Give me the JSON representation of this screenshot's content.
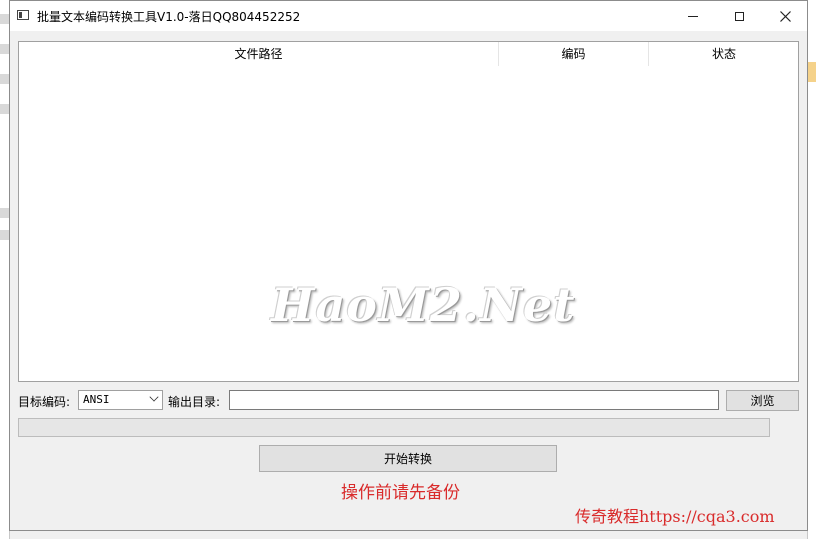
{
  "window": {
    "title": "批量文本编码转换工具V1.0-落日QQ804452252"
  },
  "list": {
    "columns": [
      {
        "label": "文件路径"
      },
      {
        "label": "编码"
      },
      {
        "label": "状态"
      }
    ],
    "rows": []
  },
  "watermark": "HaoM2.Net",
  "controls": {
    "target_encoding_label": "目标编码:",
    "target_encoding_value": "ANSI",
    "output_dir_label": "输出目录:",
    "output_dir_value": "",
    "browse_label": "浏览",
    "progress_percent": 0,
    "start_label": "开始转换"
  },
  "notices": {
    "backup_warning": "操作前请先备份",
    "footer_site": "传奇教程https://cqa3.com"
  },
  "colors": {
    "warning_red": "#d92b2b",
    "progress_green": "#06b025"
  },
  "icons": {
    "app": "app-icon",
    "minimize": "minimize-icon",
    "maximize": "maximize-icon",
    "close": "close-icon",
    "dropdown": "chevron-down-icon"
  }
}
